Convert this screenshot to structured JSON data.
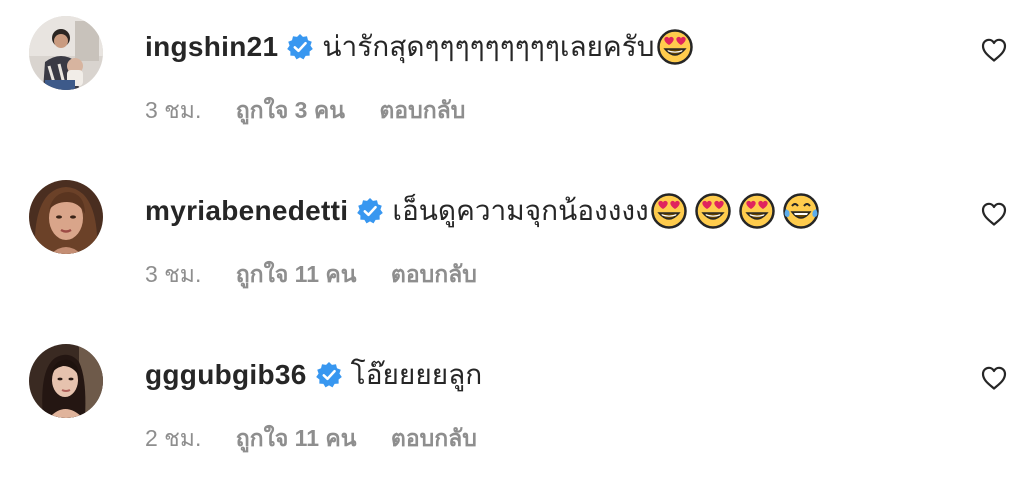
{
  "comments": [
    {
      "username": "ingshin21",
      "verified": true,
      "text": "น่ารักสุดๆๆๆๆๆๆๆๆๆเลยครับ",
      "emojis": [
        "heart-eyes"
      ],
      "time": "3 ชม.",
      "likes": "ถูกใจ 3 คน",
      "reply": "ตอบกลับ"
    },
    {
      "username": "myriabenedetti",
      "verified": true,
      "text": "เอ็นดูความจุกน้องงงง",
      "emojis": [
        "heart-eyes",
        "heart-eyes",
        "heart-eyes",
        "tears-of-joy"
      ],
      "time": "3 ชม.",
      "likes": "ถูกใจ 11 คน",
      "reply": "ตอบกลับ"
    },
    {
      "username": "gggubgib36",
      "verified": true,
      "text": "โอ๊ยยยยลูก",
      "emojis": [],
      "time": "2 ชม.",
      "likes": "ถูกใจ 11 คน",
      "reply": "ตอบกลับ"
    }
  ],
  "colors": {
    "text": "#262626",
    "secondary": "#8e8e8e",
    "verified_blue": "#3897f0"
  },
  "icons": {
    "verified": "verified-badge-icon",
    "like": "heart-outline-icon"
  }
}
